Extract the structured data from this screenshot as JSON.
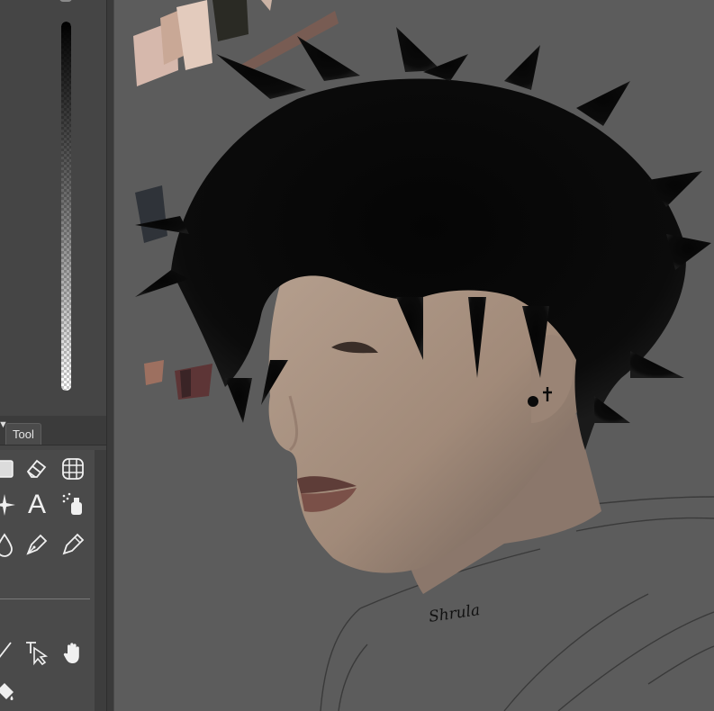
{
  "tool_panel": {
    "tab_label": "Tool",
    "tools": [
      {
        "icon": "rectangle-icon"
      },
      {
        "icon": "eraser-icon"
      },
      {
        "icon": "grid-icon"
      },
      {
        "icon": "sparkle-icon"
      },
      {
        "icon": "text-tool-icon"
      },
      {
        "icon": "airbrush-icon"
      },
      {
        "icon": "blend-drop-icon"
      },
      {
        "icon": "pen-icon"
      },
      {
        "icon": "pencil-icon"
      },
      {
        "icon": "line-icon"
      },
      {
        "icon": "object-select-icon"
      },
      {
        "icon": "hand-icon"
      },
      {
        "icon": "fill-bucket-icon"
      }
    ],
    "text_tool_glyph": "A"
  },
  "canvas": {
    "signature": "Shrula",
    "palette_swatch_colors": [
      "#e0c2b4",
      "#c9a28c",
      "#2a2a24",
      "#7b5c52",
      "#2f3339",
      "#5d3536",
      "#9d7060"
    ]
  },
  "colors": {
    "panel_bg": "#454545",
    "canvas_bg": "#5c5c5c",
    "skin": "#aa9282",
    "hair": "#0b0b0b"
  }
}
